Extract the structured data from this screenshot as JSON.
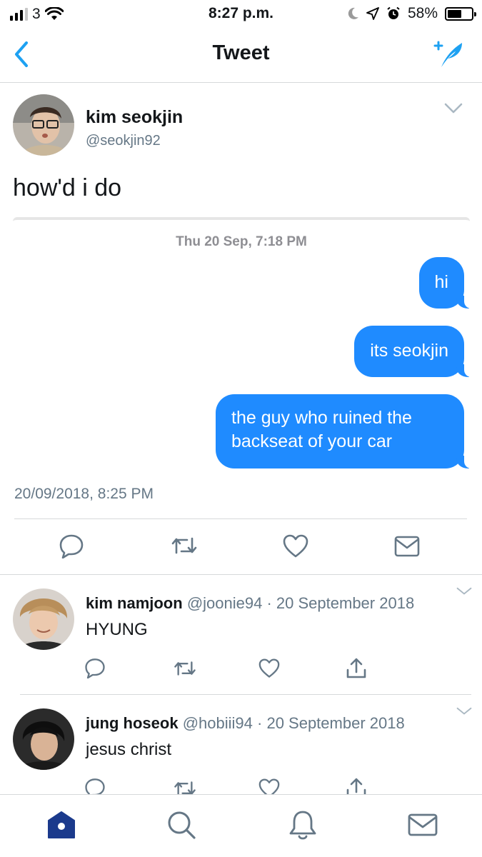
{
  "status_bar": {
    "carrier": "3",
    "time": "8:27 p.m.",
    "battery": "58%",
    "battery_level": 0.58
  },
  "nav": {
    "title": "Tweet"
  },
  "tweet": {
    "author_name": "kim seokjin",
    "author_handle": "@seokjin92",
    "text": "how'd i do",
    "media": {
      "message_date": "Thu 20 Sep, 7:18 PM",
      "messages": [
        "hi",
        "its seokjin",
        "the guy who ruined the backseat of your car"
      ]
    },
    "timestamp": "20/09/2018, 8:25 PM"
  },
  "replies": [
    {
      "name": "kim namjoon",
      "handle": "@joonie94",
      "separator": "·",
      "date": "20 September 2018",
      "text": "HYUNG"
    },
    {
      "name": "jung hoseok",
      "handle": "@hobiii94",
      "separator": "·",
      "date": "20 September 2018",
      "text": "jesus christ"
    }
  ],
  "icons": {
    "back": "chevron-left-icon",
    "compose": "compose-feather-icon",
    "reply": "reply-icon",
    "retweet": "retweet-icon",
    "like": "heart-icon",
    "dm": "envelope-icon",
    "share": "share-icon",
    "home": "home-icon",
    "search": "search-icon",
    "notifications": "bell-icon",
    "messages": "envelope-icon"
  },
  "colors": {
    "accent": "#1da1f2",
    "imessage_blue": "#1f8bff",
    "tab_active": "#1b3a8c",
    "secondary_text": "#657786"
  }
}
